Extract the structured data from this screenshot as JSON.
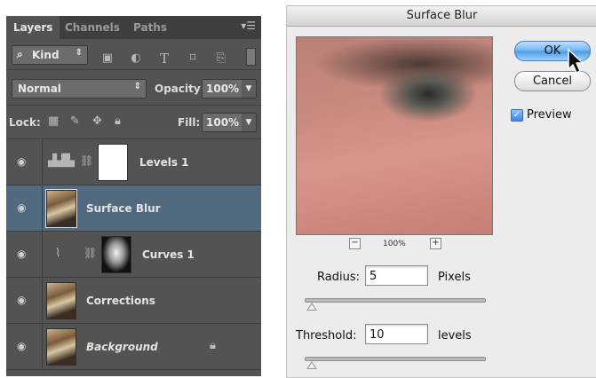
{
  "layers_panel": {
    "tabs": [
      {
        "label": "Layers",
        "active": true
      },
      {
        "label": "Channels",
        "active": false
      },
      {
        "label": "Paths",
        "active": false
      }
    ],
    "filter": {
      "label": "Kind"
    },
    "blend_mode": "Normal",
    "opacity_label": "Opacity:",
    "opacity_value": "100%",
    "lock_label": "Lock:",
    "fill_label": "Fill:",
    "fill_value": "100%",
    "layers": [
      {
        "name": "Levels 1",
        "type": "adjustment-levels",
        "selected": false,
        "italic": false
      },
      {
        "name": "Surface Blur",
        "type": "smart-object",
        "selected": true,
        "italic": false
      },
      {
        "name": "Curves 1",
        "type": "adjustment-curves",
        "selected": false,
        "italic": false
      },
      {
        "name": "Corrections",
        "type": "pixel",
        "selected": false,
        "italic": false
      },
      {
        "name": "Background",
        "type": "background",
        "selected": false,
        "italic": true,
        "locked": true
      }
    ]
  },
  "dialog": {
    "title": "Surface Blur",
    "ok_label": "OK",
    "cancel_label": "Cancel",
    "preview_label": "Preview",
    "preview_checked": true,
    "zoom_value": "100%",
    "radius_label": "Radius:",
    "radius_value": "5",
    "radius_unit": "Pixels",
    "threshold_label": "Threshold:",
    "threshold_value": "10",
    "threshold_unit": "levels"
  },
  "colors": {
    "panel_bg": "#535353",
    "selected_layer": "#516a80",
    "dialog_bg": "#ececec",
    "ok_button": "#6fb3f0"
  }
}
